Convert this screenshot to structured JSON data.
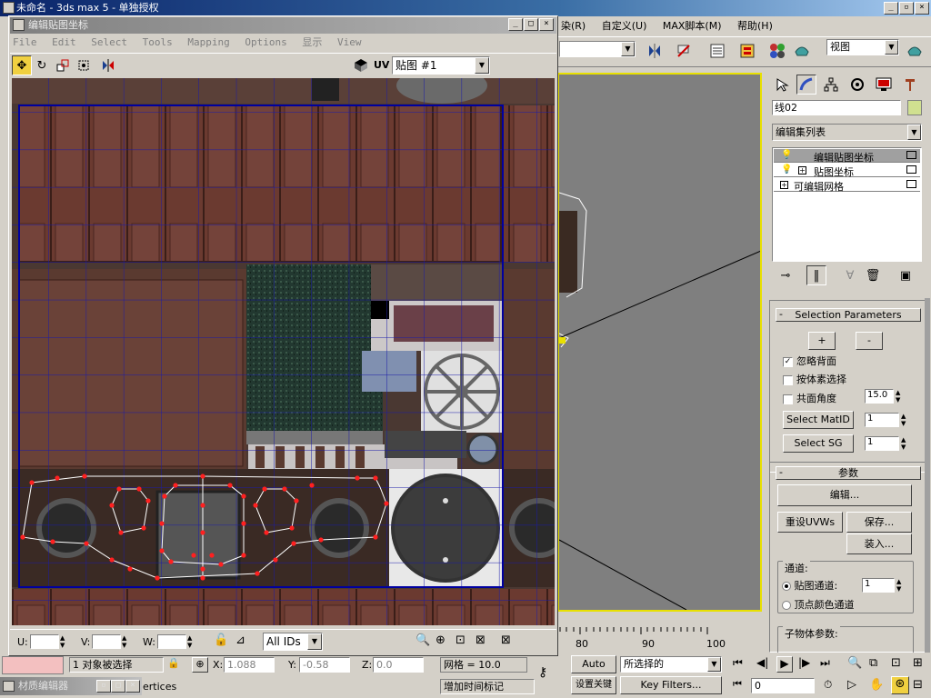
{
  "main": {
    "title": "未命名 - 3ds max 5 - 单独授权",
    "menu_right": [
      "染(R)",
      "自定义(U)",
      "MAX脚本(M)",
      "帮助(H)"
    ],
    "view_dropdown": "视图"
  },
  "uv_window": {
    "title": "编辑贴图坐标",
    "menu": [
      "File",
      "Edit",
      "Select",
      "Tools",
      "Mapping",
      "Options",
      "显示",
      "View"
    ],
    "uv_label": "UV",
    "map_dropdown": "贴图 #1",
    "coords": {
      "u_label": "U:",
      "v_label": "V:",
      "w_label": "W:"
    },
    "ids_dropdown": "All IDs"
  },
  "command_panel": {
    "object_name": "线02",
    "modifier_list": "编辑集列表",
    "stack": [
      "编辑贴图坐标",
      "贴图坐标",
      "可编辑网格"
    ],
    "selection_params": {
      "title": "Selection Parameters",
      "plus": "+",
      "minus": "-",
      "ignore_backfaces": "忽略背面",
      "select_by_element": "按体素选择",
      "planar_angle": "共面角度",
      "planar_value": "15.0",
      "select_matid": "Select MatID",
      "matid_value": "1",
      "select_sg": "Select SG",
      "sg_value": "1"
    },
    "params": {
      "title": "参数",
      "edit": "编辑...",
      "reset_uvws": "重设UVWs",
      "save": "保存...",
      "load": "装入...",
      "channel_group": "通道:",
      "map_channel": "贴图通道:",
      "map_channel_value": "1",
      "vertex_color": "顶点颜色通道",
      "subobject_params": "子物体参数:"
    }
  },
  "timeline": {
    "ticks": [
      "80",
      "90",
      "100"
    ]
  },
  "status": {
    "selection": "1 对象被选择",
    "x_label": "X:",
    "x_value": "1.088",
    "y_label": "Y:",
    "y_value": "-0.58",
    "z_label": "Z:",
    "z_value": "0.0",
    "grid": "网格 = 10.0",
    "autokey": "Auto Key",
    "selected_dropdown": "所选择的",
    "set_key": "设置关键帧",
    "key_filters": "Key Filters...",
    "add_time_tag": "增加时间标记",
    "frame_value": "0",
    "vertices_hint": "ertices",
    "material_editor": "材质编辑器"
  },
  "colors": {
    "viewport_border": "#e8e000",
    "selected_item": "#a0a0a0",
    "vertex": "#ff2020",
    "grid_line": "#1a1aaa"
  }
}
